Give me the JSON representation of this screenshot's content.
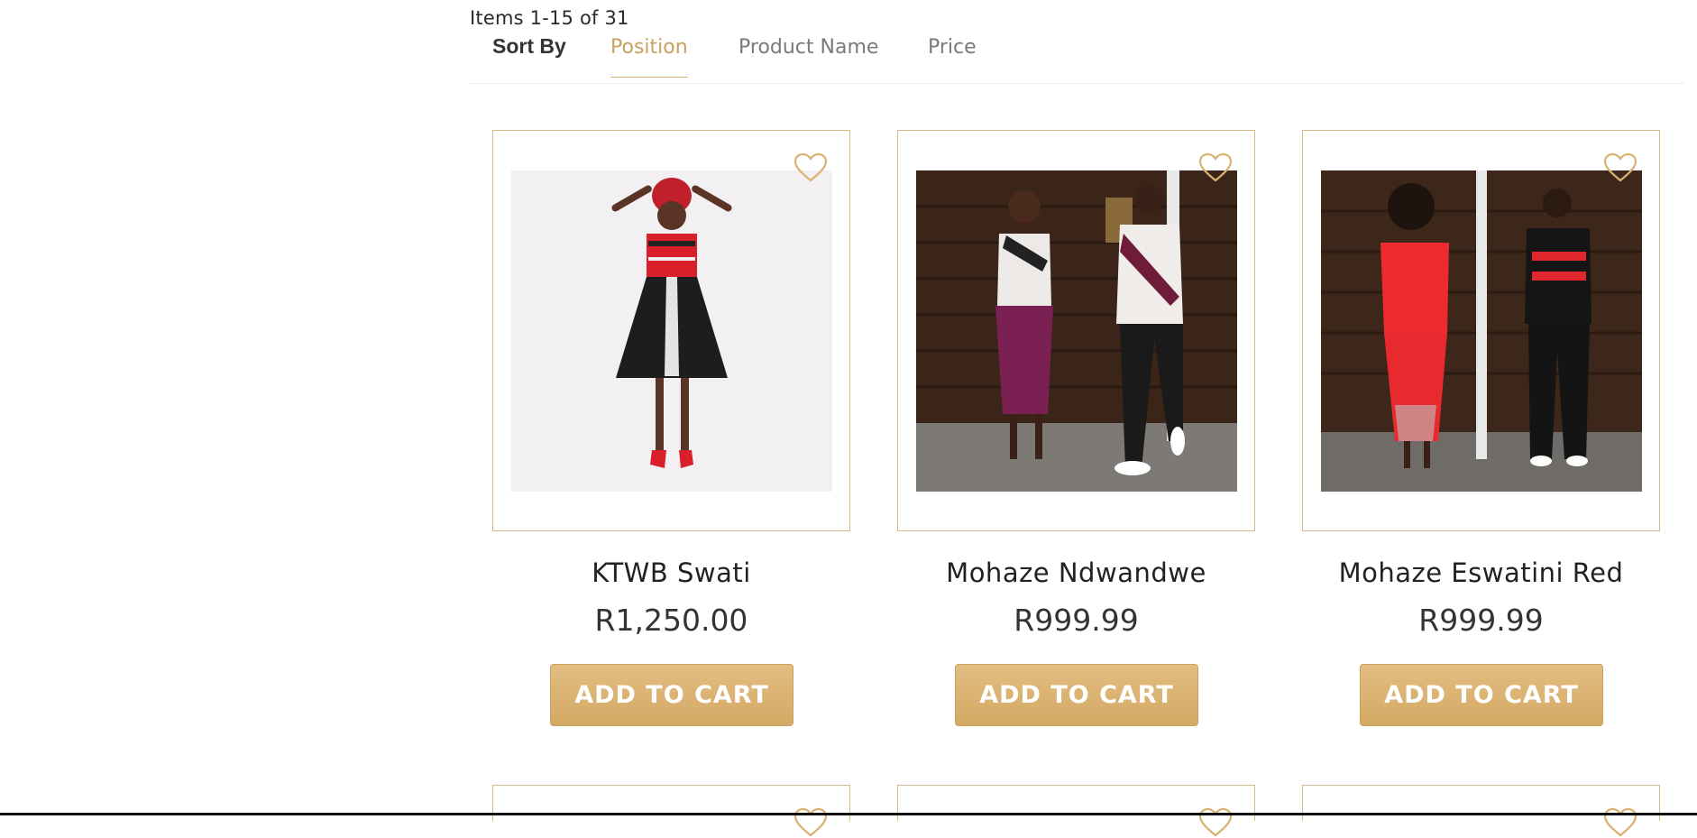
{
  "toolbar": {
    "item_count": "Items 1-15 of 31",
    "sort_label": "Sort By",
    "sort_options": [
      "Position",
      "Product Name",
      "Price"
    ],
    "active_sort": "Position"
  },
  "products": [
    {
      "name": "KTWB Swati",
      "price": "R1,250.00",
      "cta": "ADD TO CART"
    },
    {
      "name": "Mohaze Ndwandwe",
      "price": "R999.99",
      "cta": "ADD TO CART"
    },
    {
      "name": "Mohaze Eswatini Red",
      "price": "R999.99",
      "cta": "ADD TO CART"
    }
  ],
  "colors": {
    "accent": "#c9a160",
    "card_border": "#d8b985",
    "button": "#d9b171"
  },
  "icons": {
    "wishlist": "heart-icon"
  }
}
